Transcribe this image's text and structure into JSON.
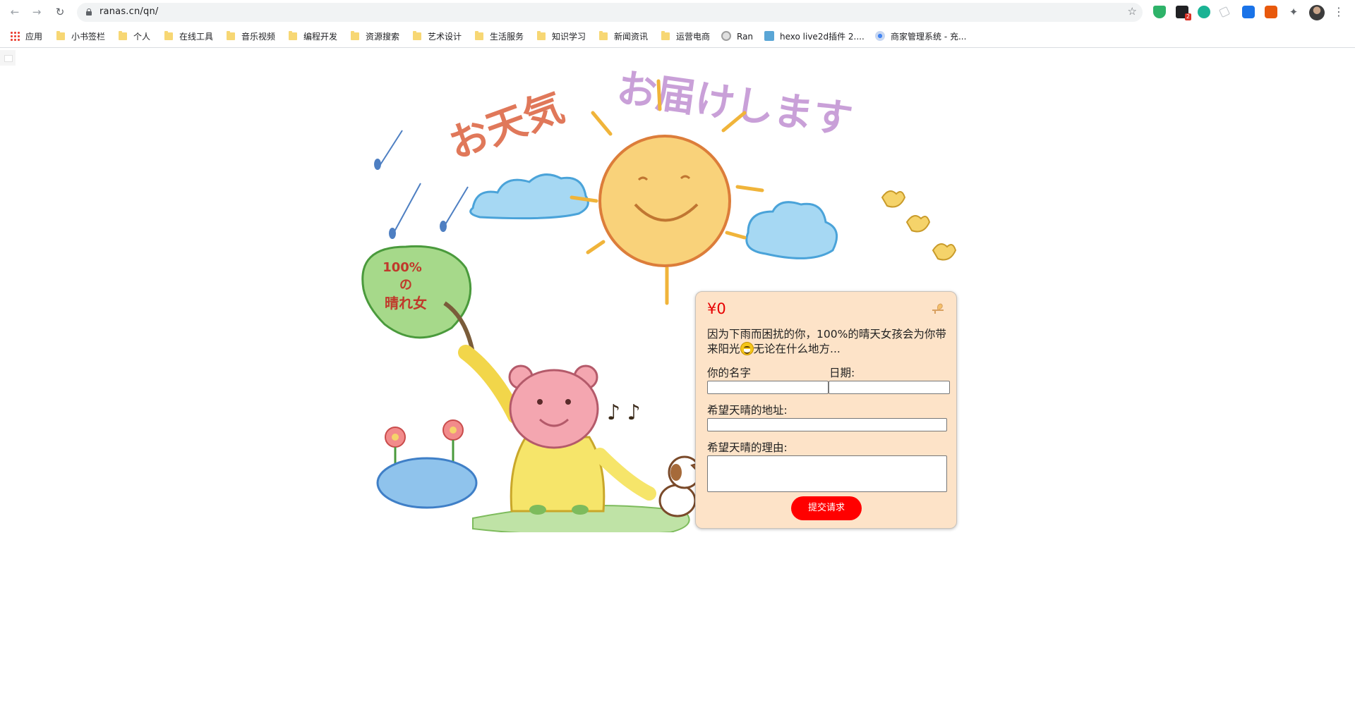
{
  "browser": {
    "url": "ranas.cn/qn/",
    "bookmarks": [
      "应用",
      "小书签栏",
      "个人",
      "在线工具",
      "音乐视频",
      "编程开发",
      "资源搜索",
      "艺术设计",
      "生活服务",
      "知识学习",
      "新闻资讯",
      "运营电商",
      "Ran",
      "hexo live2d插件 2....",
      "商家管理系统 - 充..."
    ],
    "extension_badge": "2",
    "extension_char": "G"
  },
  "illustration": {
    "title_left": "お天気",
    "title_right": "お届けします",
    "leaf_sign": [
      "100%",
      "の",
      "晴れ女"
    ],
    "music_notes": "♪ ♪"
  },
  "form": {
    "price": "¥0",
    "intro_before_emoji": "因为下雨而困扰的你，100%的晴天女孩会为你带来阳光",
    "intro_after_emoji": "无论在什么地方...",
    "name_label": "你的名字",
    "date_label": "日期:",
    "address_label": "希望天晴的地址:",
    "reason_label": "希望天晴的理由:",
    "submit_label": "提交请求"
  },
  "colors": {
    "accent": "#ff0000",
    "card_bg": "#fde3c8",
    "sun": "#f7c34a",
    "cloud": "#8ecdf0"
  }
}
